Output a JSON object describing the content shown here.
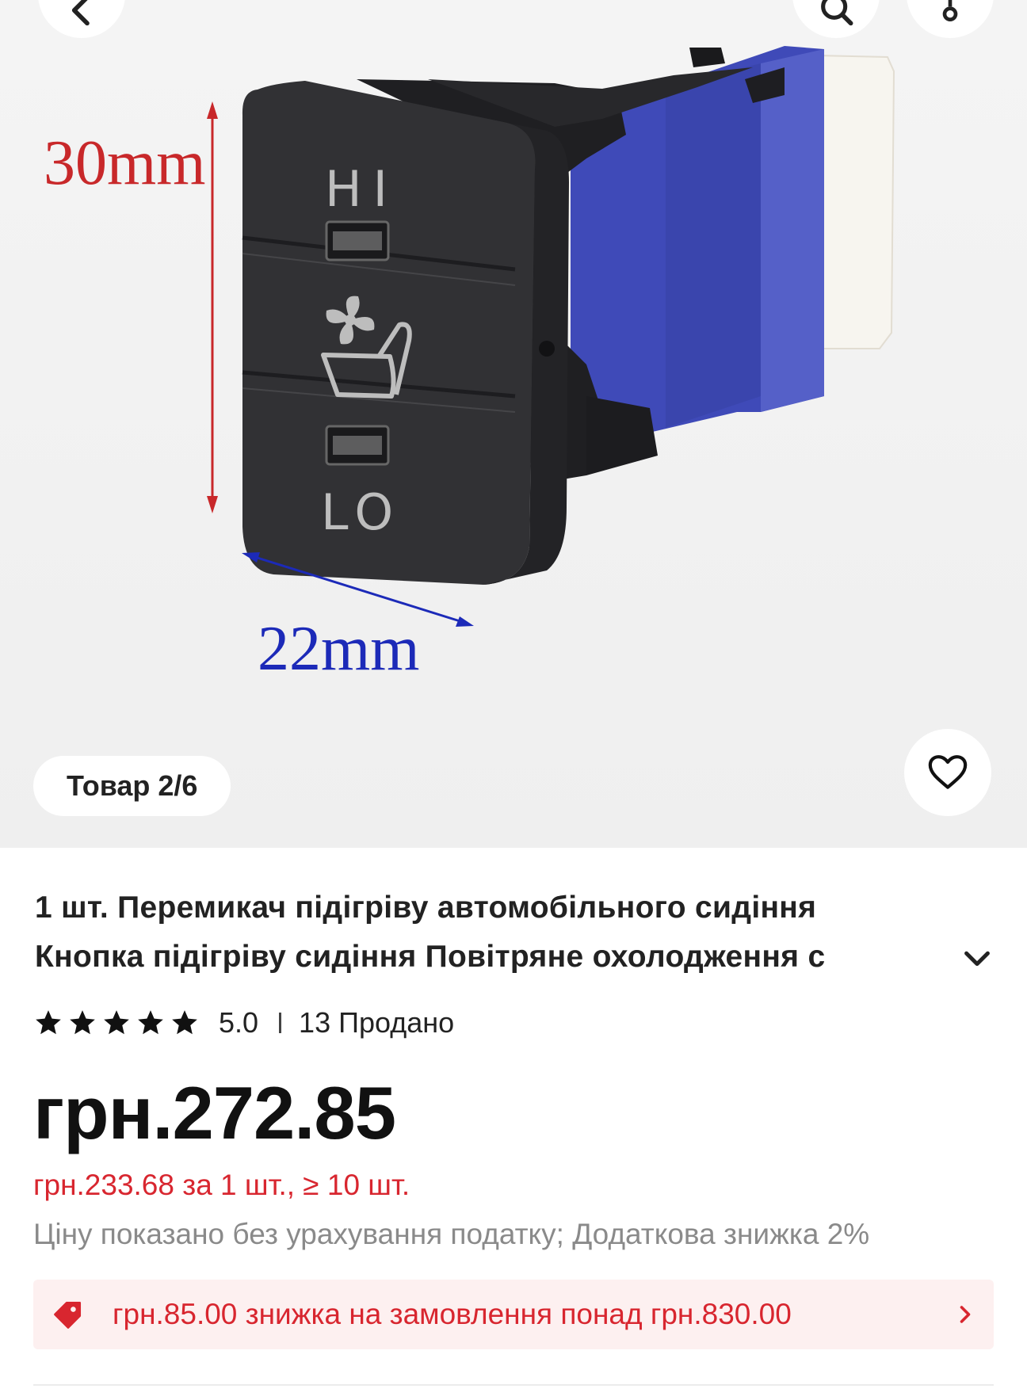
{
  "gallery": {
    "counter_label": "Товар 2/6",
    "product_labels": {
      "height_dim": "30mm",
      "width_dim": "22mm",
      "hi_label": "HI",
      "lo_label": "LO"
    },
    "icons": [
      "back-icon",
      "search-icon",
      "share-icon",
      "heart-icon"
    ]
  },
  "product": {
    "title_line1": "1 шт. Перемикач підігріву автомобільного сидіння",
    "title_line2": "Кнопка підігріву сидіння Повітряне охолодження с",
    "rating_value": "5.0",
    "rating_stars": 5,
    "sold": "13 Продано",
    "price": "грн.272.85",
    "bulk_price": "грн.233.68 за 1 шт., ≥ 10 шт.",
    "tax_note": "Ціну показано без урахування податку; Додаткова знижка 2%",
    "promo_text": "грн.85.00 знижка на замовлення понад грн.830.00"
  },
  "colors": {
    "accent_red": "#d8262f",
    "promo_bg": "#fdf0f0",
    "dim_red": "#c8282a",
    "dim_blue": "#1c2ab8"
  }
}
